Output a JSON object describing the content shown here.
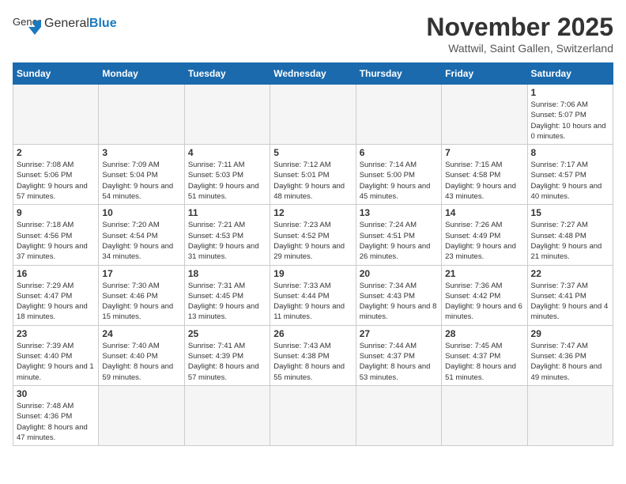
{
  "header": {
    "logo_text_regular": "General",
    "logo_text_bold": "Blue",
    "month": "November 2025",
    "location": "Wattwil, Saint Gallen, Switzerland"
  },
  "weekdays": [
    "Sunday",
    "Monday",
    "Tuesday",
    "Wednesday",
    "Thursday",
    "Friday",
    "Saturday"
  ],
  "weeks": [
    [
      {
        "day": "",
        "info": ""
      },
      {
        "day": "",
        "info": ""
      },
      {
        "day": "",
        "info": ""
      },
      {
        "day": "",
        "info": ""
      },
      {
        "day": "",
        "info": ""
      },
      {
        "day": "",
        "info": ""
      },
      {
        "day": "1",
        "info": "Sunrise: 7:06 AM\nSunset: 5:07 PM\nDaylight: 10 hours and 0 minutes."
      }
    ],
    [
      {
        "day": "2",
        "info": "Sunrise: 7:08 AM\nSunset: 5:06 PM\nDaylight: 9 hours and 57 minutes."
      },
      {
        "day": "3",
        "info": "Sunrise: 7:09 AM\nSunset: 5:04 PM\nDaylight: 9 hours and 54 minutes."
      },
      {
        "day": "4",
        "info": "Sunrise: 7:11 AM\nSunset: 5:03 PM\nDaylight: 9 hours and 51 minutes."
      },
      {
        "day": "5",
        "info": "Sunrise: 7:12 AM\nSunset: 5:01 PM\nDaylight: 9 hours and 48 minutes."
      },
      {
        "day": "6",
        "info": "Sunrise: 7:14 AM\nSunset: 5:00 PM\nDaylight: 9 hours and 45 minutes."
      },
      {
        "day": "7",
        "info": "Sunrise: 7:15 AM\nSunset: 4:58 PM\nDaylight: 9 hours and 43 minutes."
      },
      {
        "day": "8",
        "info": "Sunrise: 7:17 AM\nSunset: 4:57 PM\nDaylight: 9 hours and 40 minutes."
      }
    ],
    [
      {
        "day": "9",
        "info": "Sunrise: 7:18 AM\nSunset: 4:56 PM\nDaylight: 9 hours and 37 minutes."
      },
      {
        "day": "10",
        "info": "Sunrise: 7:20 AM\nSunset: 4:54 PM\nDaylight: 9 hours and 34 minutes."
      },
      {
        "day": "11",
        "info": "Sunrise: 7:21 AM\nSunset: 4:53 PM\nDaylight: 9 hours and 31 minutes."
      },
      {
        "day": "12",
        "info": "Sunrise: 7:23 AM\nSunset: 4:52 PM\nDaylight: 9 hours and 29 minutes."
      },
      {
        "day": "13",
        "info": "Sunrise: 7:24 AM\nSunset: 4:51 PM\nDaylight: 9 hours and 26 minutes."
      },
      {
        "day": "14",
        "info": "Sunrise: 7:26 AM\nSunset: 4:49 PM\nDaylight: 9 hours and 23 minutes."
      },
      {
        "day": "15",
        "info": "Sunrise: 7:27 AM\nSunset: 4:48 PM\nDaylight: 9 hours and 21 minutes."
      }
    ],
    [
      {
        "day": "16",
        "info": "Sunrise: 7:29 AM\nSunset: 4:47 PM\nDaylight: 9 hours and 18 minutes."
      },
      {
        "day": "17",
        "info": "Sunrise: 7:30 AM\nSunset: 4:46 PM\nDaylight: 9 hours and 15 minutes."
      },
      {
        "day": "18",
        "info": "Sunrise: 7:31 AM\nSunset: 4:45 PM\nDaylight: 9 hours and 13 minutes."
      },
      {
        "day": "19",
        "info": "Sunrise: 7:33 AM\nSunset: 4:44 PM\nDaylight: 9 hours and 11 minutes."
      },
      {
        "day": "20",
        "info": "Sunrise: 7:34 AM\nSunset: 4:43 PM\nDaylight: 9 hours and 8 minutes."
      },
      {
        "day": "21",
        "info": "Sunrise: 7:36 AM\nSunset: 4:42 PM\nDaylight: 9 hours and 6 minutes."
      },
      {
        "day": "22",
        "info": "Sunrise: 7:37 AM\nSunset: 4:41 PM\nDaylight: 9 hours and 4 minutes."
      }
    ],
    [
      {
        "day": "23",
        "info": "Sunrise: 7:39 AM\nSunset: 4:40 PM\nDaylight: 9 hours and 1 minute."
      },
      {
        "day": "24",
        "info": "Sunrise: 7:40 AM\nSunset: 4:40 PM\nDaylight: 8 hours and 59 minutes."
      },
      {
        "day": "25",
        "info": "Sunrise: 7:41 AM\nSunset: 4:39 PM\nDaylight: 8 hours and 57 minutes."
      },
      {
        "day": "26",
        "info": "Sunrise: 7:43 AM\nSunset: 4:38 PM\nDaylight: 8 hours and 55 minutes."
      },
      {
        "day": "27",
        "info": "Sunrise: 7:44 AM\nSunset: 4:37 PM\nDaylight: 8 hours and 53 minutes."
      },
      {
        "day": "28",
        "info": "Sunrise: 7:45 AM\nSunset: 4:37 PM\nDaylight: 8 hours and 51 minutes."
      },
      {
        "day": "29",
        "info": "Sunrise: 7:47 AM\nSunset: 4:36 PM\nDaylight: 8 hours and 49 minutes."
      }
    ],
    [
      {
        "day": "30",
        "info": "Sunrise: 7:48 AM\nSunset: 4:36 PM\nDaylight: 8 hours and 47 minutes."
      },
      {
        "day": "",
        "info": ""
      },
      {
        "day": "",
        "info": ""
      },
      {
        "day": "",
        "info": ""
      },
      {
        "day": "",
        "info": ""
      },
      {
        "day": "",
        "info": ""
      },
      {
        "day": "",
        "info": ""
      }
    ]
  ]
}
